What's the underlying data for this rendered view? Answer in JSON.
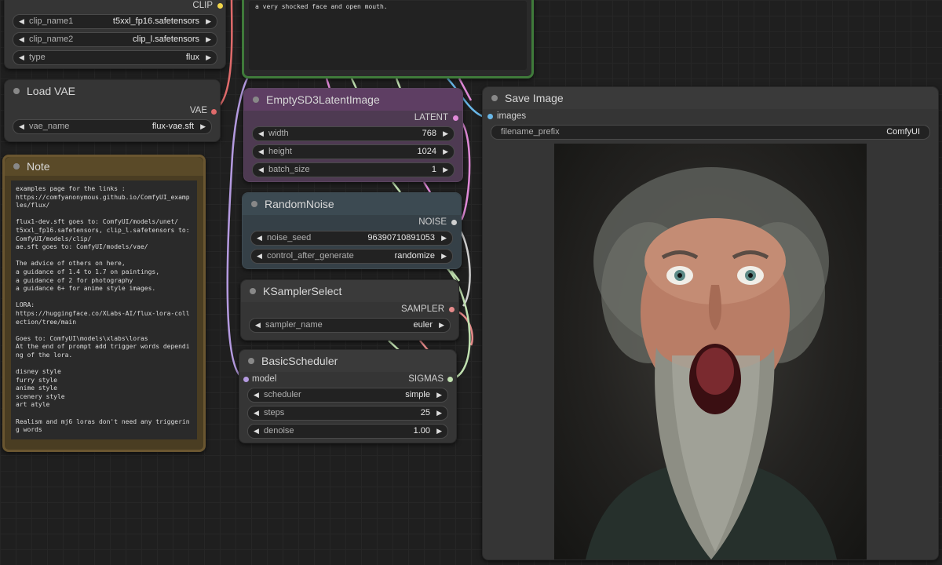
{
  "colors": {
    "clip": "#f1d54a",
    "vae": "#e06b6b",
    "latent": "#e08ad8",
    "noise": "#9a9a9a",
    "sampler": "#e58a8a",
    "sigmas": "#c0e0b0",
    "model": "#b49ae0",
    "image": "#69b7e8"
  },
  "clip_loader": {
    "output_label": "CLIP",
    "widgets": [
      {
        "label": "clip_name1",
        "value": "t5xxl_fp16.safetensors"
      },
      {
        "label": "clip_name2",
        "value": "clip_l.safetensors"
      },
      {
        "label": "type",
        "value": "flux"
      }
    ]
  },
  "prompt_node": {
    "text": "a very shocked face and open mouth."
  },
  "load_vae": {
    "title": "Load VAE",
    "output_label": "VAE",
    "widgets": [
      {
        "label": "vae_name",
        "value": "flux-vae.sft"
      }
    ]
  },
  "note": {
    "title": "Note",
    "text": "examples page for the links :\nhttps://comfyanonymous.github.io/ComfyUI_examples/flux/\n\nflux1-dev.sft goes to: ComfyUI/models/unet/\nt5xxl_fp16.safetensors, clip_l.safetensors to:\nComfyUI/models/clip/\nae.sft goes to: ComfyUI/models/vae/\n\nThe advice of others on here,\na guidance of 1.4 to 1.7 on paintings,\na guidance of 2 for photography\na guidance 6+ for anime style images.\n\nLORA:\nhttps://huggingface.co/XLabs-AI/flux-lora-collection/tree/main\n\nGoes to: ComfyUI\\models\\xlabs\\loras\nAt the end of prompt add trigger words depending of the lora.\n\ndisney style\nfurry style\nanime style\nscenery style\nart atyle\n\nRealism and mj6 loras don't need any triggering words"
  },
  "empty_latent": {
    "title": "EmptySD3LatentImage",
    "output_label": "LATENT",
    "widgets": [
      {
        "label": "width",
        "value": "768"
      },
      {
        "label": "height",
        "value": "1024"
      },
      {
        "label": "batch_size",
        "value": "1"
      }
    ]
  },
  "random_noise": {
    "title": "RandomNoise",
    "output_label": "NOISE",
    "widgets": [
      {
        "label": "noise_seed",
        "value": "96390710891053"
      },
      {
        "label": "control_after_generate",
        "value": "randomize"
      }
    ]
  },
  "ksampler_select": {
    "title": "KSamplerSelect",
    "output_label": "SAMPLER",
    "widgets": [
      {
        "label": "sampler_name",
        "value": "euler"
      }
    ]
  },
  "basic_scheduler": {
    "title": "BasicScheduler",
    "input_label": "model",
    "output_label": "SIGMAS",
    "widgets": [
      {
        "label": "scheduler",
        "value": "simple"
      },
      {
        "label": "steps",
        "value": "25"
      },
      {
        "label": "denoise",
        "value": "1.00"
      }
    ]
  },
  "save_image": {
    "title": "Save Image",
    "input_label": "images",
    "widgets": [
      {
        "label": "filename_prefix",
        "value": "ComfyUI"
      }
    ]
  }
}
